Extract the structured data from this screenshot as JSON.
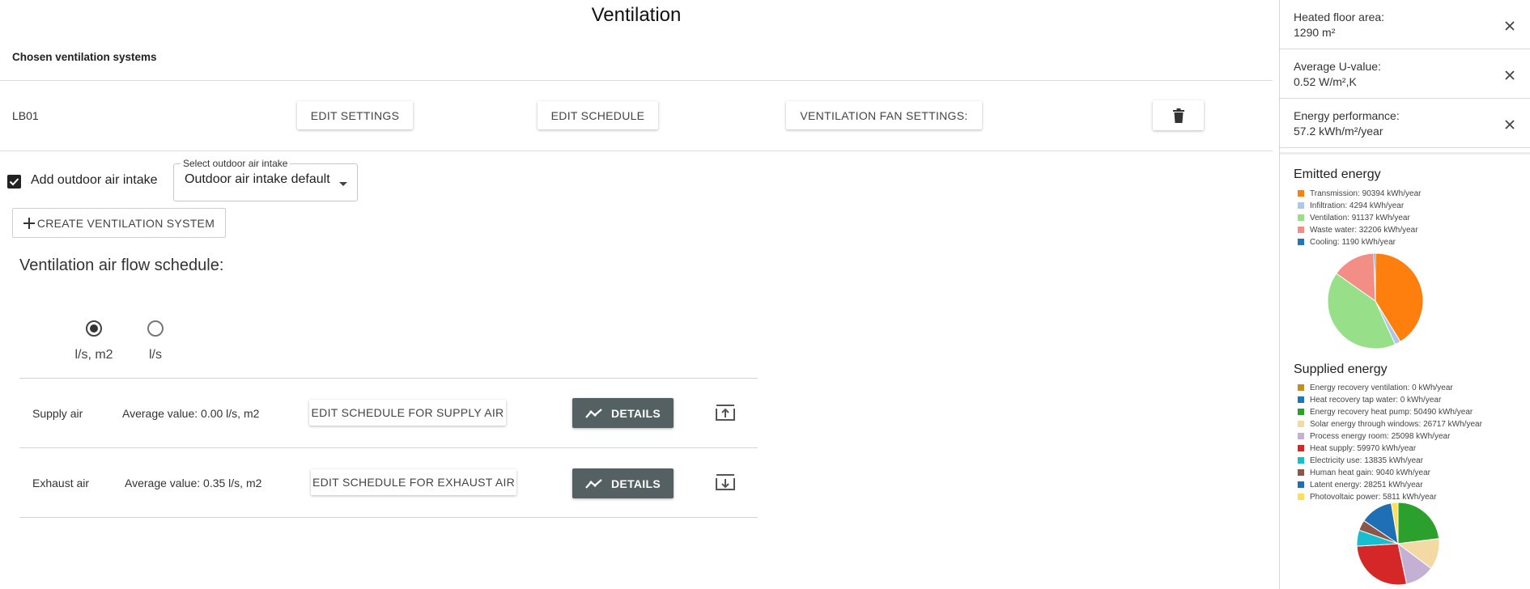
{
  "page": {
    "title": "Ventilation"
  },
  "systems": {
    "section_title": "Chosen ventilation systems",
    "items": [
      {
        "name": "LB01",
        "edit_settings_label": "EDIT SETTINGS",
        "edit_schedule_label": "EDIT SCHEDULE",
        "fan_settings_label": "VENTILATION FAN SETTINGS:"
      }
    ]
  },
  "outdoor_air": {
    "checkbox_label": "Add outdoor air intake",
    "checked": true,
    "select_label": "Select outdoor air intake",
    "select_value": "Outdoor air intake default"
  },
  "create_button_label": "CREATE VENTILATION SYSTEM",
  "schedule": {
    "title": "Ventilation air flow schedule:",
    "unit_options": [
      {
        "label": "l/s, m2",
        "selected": true
      },
      {
        "label": "l/s",
        "selected": false
      }
    ],
    "rows": [
      {
        "label": "Supply air",
        "average": "Average value: 0.00 l/s, m2",
        "edit_label": "EDIT SCHEDULE FOR SUPPLY AIR",
        "details_label": "DETAILS",
        "icon": "upload-icon"
      },
      {
        "label": "Exhaust air",
        "average": "Average value: 0.35 l/s, m2",
        "edit_label": "EDIT SCHEDULE FOR EXHAUST AIR",
        "details_label": "DETAILS",
        "icon": "download-icon"
      }
    ]
  },
  "sidebar": {
    "cards": [
      {
        "label": "Heated floor area:",
        "value": "1290 m²"
      },
      {
        "label": "Average U-value:",
        "value": "0.52 W/m²,K"
      },
      {
        "label": "Energy performance:",
        "value": "57.2 kWh/m²/year"
      }
    ]
  },
  "chart_data": [
    {
      "type": "pie",
      "title": "Emitted energy",
      "unit": "kWh/year",
      "categories": [
        "Transmission",
        "Infiltration",
        "Ventilation",
        "Waste water",
        "Cooling"
      ],
      "values": [
        90394,
        4294,
        91137,
        32206,
        1190
      ],
      "legend": [
        "Transmission: 90394 kWh/year",
        "Infiltration: 4294 kWh/year",
        "Ventilation: 91137 kWh/year",
        "Waste water: 32206 kWh/year",
        "Cooling: 1190 kWh/year"
      ],
      "colors": [
        "#ff7f0e",
        "#aec7e8",
        "#98df8a",
        "#f28e86",
        "#1f77b4"
      ],
      "legend_position": "top"
    },
    {
      "type": "pie",
      "title": "Supplied energy",
      "unit": "kWh/year",
      "categories": [
        "Energy recovery ventilation",
        "Heat recovery tap water",
        "Energy recovery heat pump",
        "Solar energy through windows",
        "Process energy room",
        "Heat supply",
        "Electricity use",
        "Human heat gain",
        "Latent energy",
        "Photovoltaic power"
      ],
      "values": [
        0,
        0,
        50490,
        26717,
        25098,
        59970,
        13835,
        9040,
        28251,
        5811
      ],
      "legend": [
        "Energy recovery ventilation: 0 kWh/year",
        "Heat recovery tap water: 0 kWh/year",
        "Energy recovery heat pump: 50490 kWh/year",
        "Solar energy through windows: 26717 kWh/year",
        "Process energy room: 25098 kWh/year",
        "Heat supply: 59970 kWh/year",
        "Electricity use: 13835 kWh/year",
        "Human heat gain: 9040 kWh/year",
        "Latent energy: 28251 kWh/year",
        "Photovoltaic power: 5811 kWh/year"
      ],
      "colors": [
        "#bf8f1f",
        "#1f77b4",
        "#2ca02c",
        "#f3d9a3",
        "#c5b0d5",
        "#d62728",
        "#17becf",
        "#8c564b",
        "#1f6fb4",
        "#ffdf5a"
      ],
      "legend_position": "top"
    }
  ]
}
